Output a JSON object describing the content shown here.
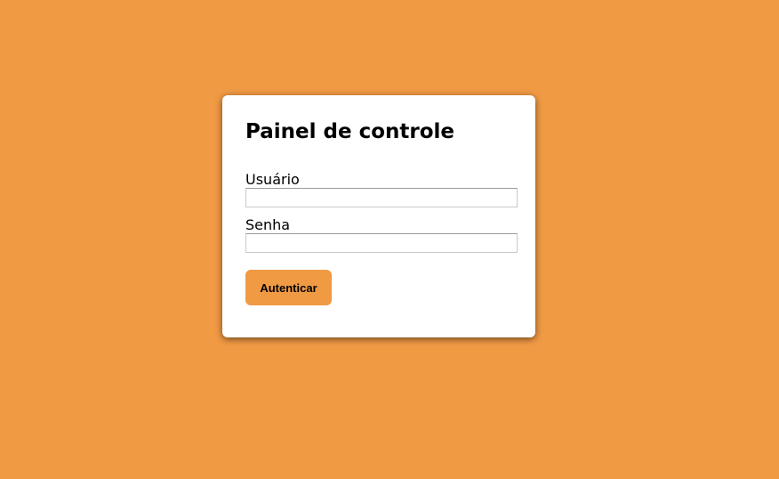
{
  "panel": {
    "title": "Painel de controle",
    "username_label": "Usuário",
    "username_value": "",
    "password_label": "Senha",
    "password_value": "",
    "submit_label": "Autenticar"
  },
  "colors": {
    "background": "#f09a44",
    "card": "#ffffff",
    "button": "#f09a44"
  }
}
